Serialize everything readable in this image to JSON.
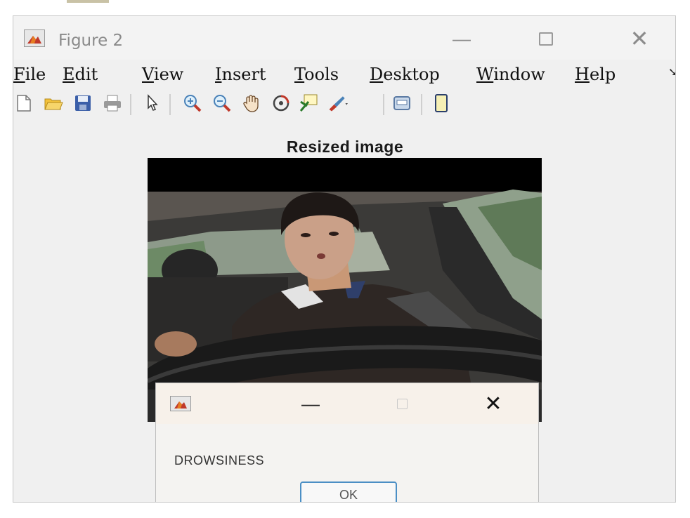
{
  "window": {
    "title": "Figure 2",
    "minimize_glyph": "—",
    "close_glyph": "✕"
  },
  "menu": [
    {
      "id": "file",
      "u": "F",
      "rest": "ile"
    },
    {
      "id": "edit",
      "u": "E",
      "rest": "dit"
    },
    {
      "id": "view",
      "u": "V",
      "rest": "iew"
    },
    {
      "id": "insert",
      "u": "I",
      "rest": "nsert"
    },
    {
      "id": "tools",
      "u": "T",
      "rest": "ools"
    },
    {
      "id": "desktop",
      "u": "D",
      "rest": "esktop"
    },
    {
      "id": "window",
      "u": "W",
      "rest": "indow"
    },
    {
      "id": "help",
      "u": "H",
      "rest": "elp"
    }
  ],
  "menu_overflow": "➘",
  "toolbar": [
    "new-figure-icon",
    "open-file-icon",
    "save-icon",
    "print-icon",
    "pointer-icon",
    "zoom-in-icon",
    "zoom-out-icon",
    "pan-icon",
    "rotate-3d-icon",
    "data-cursor-icon",
    "brush-icon",
    "link-plot-icon",
    "colorbar-icon"
  ],
  "figure": {
    "title": "Resized image"
  },
  "dialog": {
    "minimize_glyph": "—",
    "close_glyph": "✕",
    "message": "DROWSINESS",
    "ok_label": "OK"
  },
  "colors": {
    "window_bg": "#f0f0f0",
    "dialog_bg": "#f4f3f1",
    "ok_border": "#4b8fc5"
  }
}
